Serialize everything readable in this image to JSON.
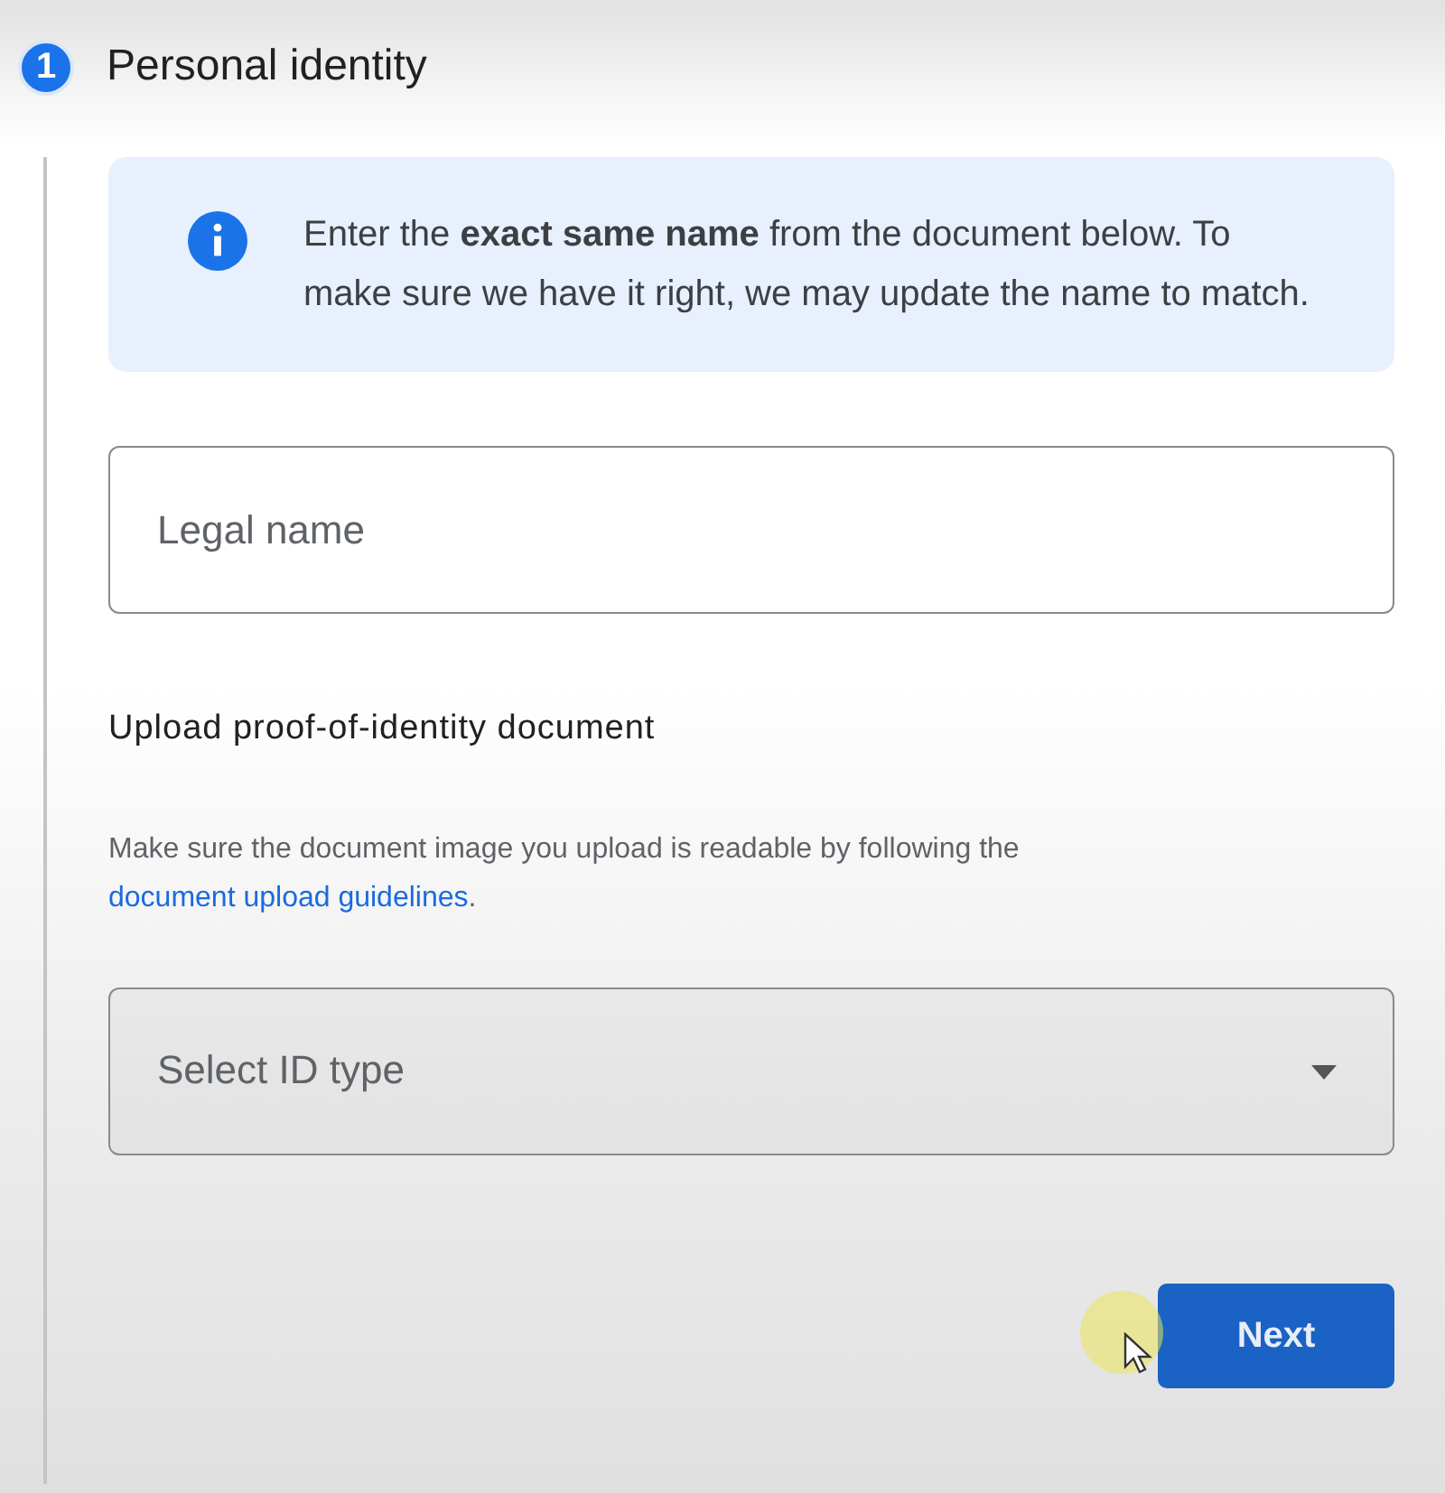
{
  "step": {
    "number": "1",
    "title": "Personal identity"
  },
  "info": {
    "text": "Enter the **exact same name** from the document below. To make sure we have it right, we may update the name to match."
  },
  "legal_name": {
    "placeholder": "Legal name"
  },
  "upload": {
    "heading": "Upload proof-of-identity document",
    "help_text": "Make sure the document image you upload is readable by following the",
    "link": "document upload guidelines",
    "help_text_end": "."
  },
  "id_type": {
    "placeholder": "Select ID type"
  },
  "next_button": {
    "label": "Next"
  }
}
